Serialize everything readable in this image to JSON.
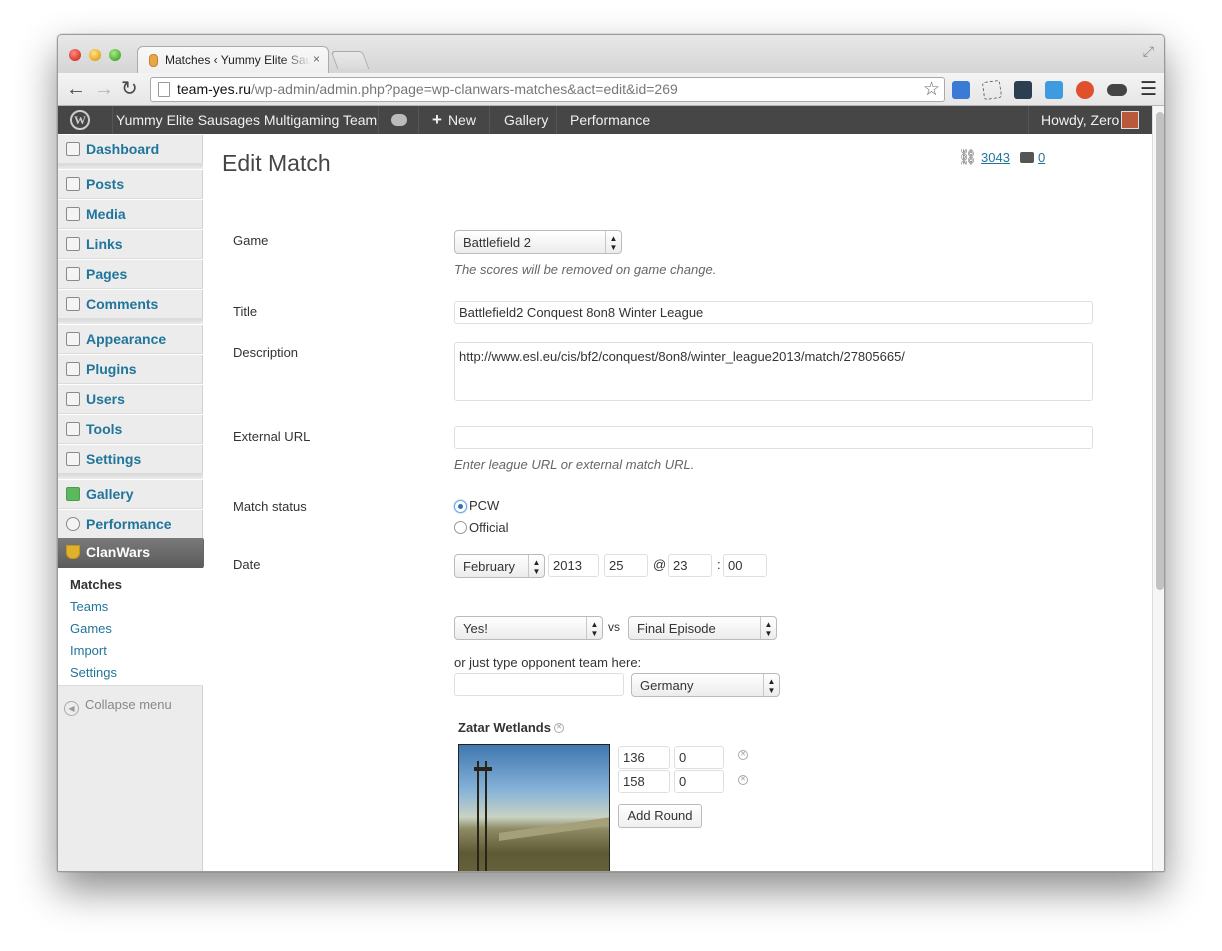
{
  "browser": {
    "tab_title": "Matches ‹ Yummy Elite Sausages Multigaming Team",
    "tab_close": "×",
    "url_host": "team-yes.ru",
    "url_path": "/wp-admin/admin.php?page=wp-clanwars-matches&act=edit&id=269"
  },
  "admin_bar": {
    "site_name": "Yummy Elite Sausages Multigaming Team",
    "new_label": "New",
    "gallery_label": "Gallery",
    "performance_label": "Performance",
    "howdy": "Howdy, Zero"
  },
  "sidebar": {
    "items": [
      {
        "label": "Dashboard",
        "icon": "house-icon"
      },
      {
        "label": "Posts",
        "icon": "pin-icon"
      },
      {
        "label": "Media",
        "icon": "media-icon"
      },
      {
        "label": "Links",
        "icon": "link-icon"
      },
      {
        "label": "Pages",
        "icon": "pages-icon"
      },
      {
        "label": "Comments",
        "icon": "comment-icon"
      },
      {
        "label": "Appearance",
        "icon": "appearance-icon"
      },
      {
        "label": "Plugins",
        "icon": "plug-icon"
      },
      {
        "label": "Users",
        "icon": "users-icon"
      },
      {
        "label": "Tools",
        "icon": "tools-icon"
      },
      {
        "label": "Settings",
        "icon": "settings-icon"
      },
      {
        "label": "Gallery",
        "icon": "gallery-icon"
      },
      {
        "label": "Performance",
        "icon": "performance-icon"
      },
      {
        "label": "ClanWars",
        "icon": "trophy-icon"
      }
    ],
    "submenu": [
      "Matches",
      "Teams",
      "Games",
      "Import",
      "Settings"
    ],
    "collapse": "Collapse menu"
  },
  "page": {
    "title": "Edit Match",
    "link_count": "3043",
    "comment_count": "0"
  },
  "form": {
    "game_label": "Game",
    "game_value": "Battlefield 2",
    "game_hint": "The scores will be removed on game change.",
    "title_label": "Title",
    "title_value": "Battlefield2 Conquest 8on8 Winter League",
    "description_label": "Description",
    "description_value": "http://www.esl.eu/cis/bf2/conquest/8on8/winter_league2013/match/27805665/",
    "external_url_label": "External URL",
    "external_url_value": "",
    "external_url_hint": "Enter league URL or external match URL.",
    "match_status_label": "Match status",
    "status_options": [
      "PCW",
      "Official"
    ],
    "status_selected": "PCW",
    "date_label": "Date",
    "date_month": "February",
    "date_year": "2013",
    "date_day": "25",
    "date_at": "@",
    "date_hour": "23",
    "date_colon": ":",
    "date_minute": "00",
    "team_1": "Yes!",
    "vs_label": "vs",
    "team_2": "Final Episode",
    "opponent_hint": "or just type opponent team here:",
    "opponent_value": "",
    "country": "Germany",
    "map_name": "Zatar Wetlands",
    "rounds": [
      {
        "score_1": "136",
        "score_2": "0"
      },
      {
        "score_1": "158",
        "score_2": "0"
      }
    ],
    "add_round_label": "Add Round"
  }
}
